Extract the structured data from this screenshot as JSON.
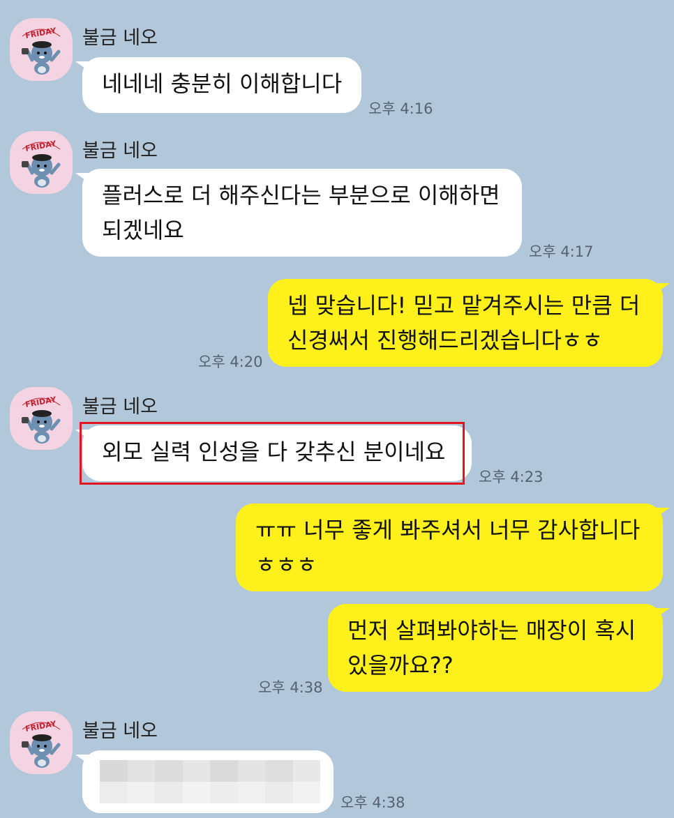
{
  "chat": {
    "messages": [
      {
        "sender": "불금 네오",
        "direction": "in",
        "lines": [
          "네네네 충분히 이해합니다"
        ],
        "time": "오후 4:16"
      },
      {
        "sender": "불금 네오",
        "direction": "in",
        "lines": [
          "플러스로 더 해주신다는 부분으로 이해하면",
          "되겠네요"
        ],
        "time": "오후 4:17"
      },
      {
        "direction": "out",
        "lines": [
          "넵 맞습니다! 믿고 맡겨주시는 만큼 더",
          "신경써서 진행해드리겠습니다ㅎㅎ"
        ],
        "time": "오후 4:20"
      },
      {
        "sender": "불금 네오",
        "direction": "in",
        "lines": [
          "외모 실력 인성을 다 갖추신 분이네요"
        ],
        "time": "오후 4:23",
        "highlighted": true
      },
      {
        "direction": "out",
        "lines": [
          "ㅠㅠ 너무 좋게 봐주셔서 너무 감사합니다",
          "ㅎㅎㅎ"
        ]
      },
      {
        "direction": "out",
        "lines": [
          "먼저 살펴봐야하는 매장이 혹시",
          "있을까요??"
        ],
        "time": "오후 4:38"
      },
      {
        "sender": "불금 네오",
        "direction": "in",
        "lines": [],
        "content": "blurred",
        "time": "오후 4:38"
      }
    ]
  },
  "avatar": {
    "sticker_text": "FRIDAY",
    "icon": "neo-friday-avatar-icon"
  },
  "colors": {
    "background": "#b2c7da",
    "incoming_bubble": "#ffffff",
    "outgoing_bubble": "#fef01b",
    "highlight_border": "#e1141f",
    "avatar_bg": "#f4d4e2"
  }
}
